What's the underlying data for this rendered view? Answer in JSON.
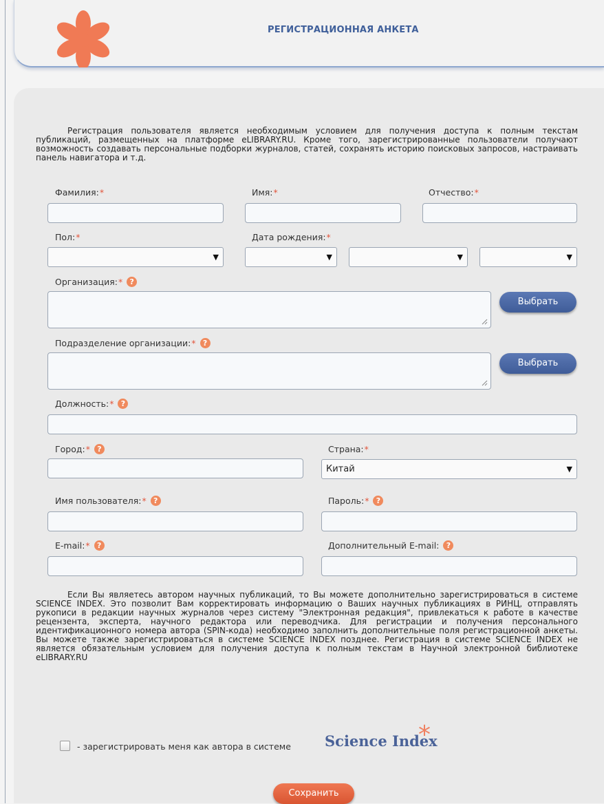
{
  "header": {
    "title": "РЕГИСТРАЦИОННАЯ АНКЕТА"
  },
  "intro": "Регистрация пользователя является необходимым условием для получения доступа к полным текстам публикаций, размещенных на платформе eLIBRARY.RU. Кроме того, зарегистрированные пользователи получают возможность создавать персональные подборки журналов, статей, сохранять историю поисковых запросов, настраивать панель навигатора и т.д.",
  "required_mark": "*",
  "help_glyph": "?",
  "fields": {
    "lastname": {
      "label": "Фамилия:",
      "value": ""
    },
    "firstname": {
      "label": "Имя:",
      "value": ""
    },
    "patronymic": {
      "label": "Отчество:",
      "value": ""
    },
    "gender": {
      "label": "Пол:",
      "value": ""
    },
    "birthdate": {
      "label": "Дата рождения:",
      "day": "",
      "month": "",
      "year": ""
    },
    "organization": {
      "label": "Организация:",
      "value": "",
      "button": "Выбрать"
    },
    "department": {
      "label": "Подразделение организации:",
      "value": "",
      "button": "Выбрать"
    },
    "position": {
      "label": "Должность:",
      "value": ""
    },
    "city": {
      "label": "Город:",
      "value": ""
    },
    "country": {
      "label": "Страна:",
      "value": "Китай"
    },
    "username": {
      "label": "Имя пользователя:",
      "value": ""
    },
    "password": {
      "label": "Пароль:",
      "value": ""
    },
    "email": {
      "label": "E-mail:",
      "value": ""
    },
    "email2": {
      "label": "Дополнительный E-mail:",
      "value": ""
    }
  },
  "science_info": "Если Вы являетесь автором научных публикаций, то Вы можете дополнительно зарегистрироваться в системе SCIENCE INDEX. Это позволит Вам корректировать информацию о Ваших научных публикациях в РИНЦ, отправлять рукописи в редакции научных журналов через систему \"Электронная редакция\", привлекаться к работе в качестве рецензента, эксперта, научного редактора или переводчика. Для регистрации и получения персонального идентификационного номера автора (SPIN-кода) необходимо заполнить дополнительные поля регистрационной анкеты. Вы можете также зарегистрироваться в системе SCIENCE INDEX позднее. Регистрация в системе SCIENCE INDEX не является обязательным условием для получения доступа к полным текстам в Научной электронной библиотеке eLIBRARY.RU",
  "science_checkbox": {
    "label": "- зарегистрировать меня как автора в системе",
    "brand": "Science Index",
    "checked": false
  },
  "save_button": "Сохранить",
  "colors": {
    "accent_blue": "#3f5f9a",
    "accent_orange": "#f08060",
    "required": "#e2553c"
  }
}
